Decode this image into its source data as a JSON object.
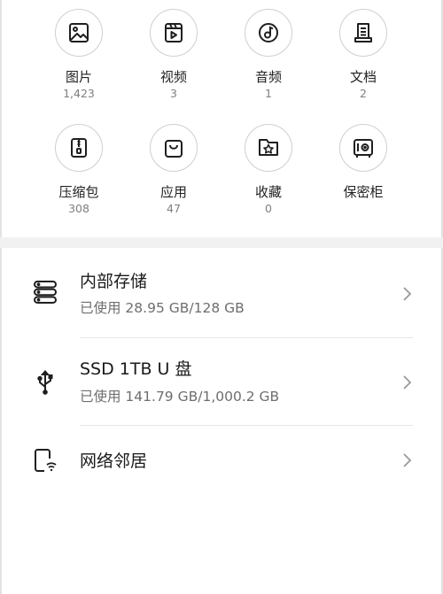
{
  "categories": [
    {
      "label": "图片",
      "count": "1,423",
      "icon": "image-icon"
    },
    {
      "label": "视频",
      "count": "3",
      "icon": "video-icon"
    },
    {
      "label": "音频",
      "count": "1",
      "icon": "audio-icon"
    },
    {
      "label": "文档",
      "count": "2",
      "icon": "document-icon"
    },
    {
      "label": "压缩包",
      "count": "308",
      "icon": "archive-icon"
    },
    {
      "label": "应用",
      "count": "47",
      "icon": "app-bag-icon"
    },
    {
      "label": "收藏",
      "count": "0",
      "icon": "favorites-icon"
    },
    {
      "label": "保密柜",
      "count": "",
      "icon": "safe-icon"
    }
  ],
  "storage": [
    {
      "title": "内部存储",
      "subtitle": "已使用 28.95 GB/128 GB",
      "icon": "internal-storage-icon"
    },
    {
      "title": "SSD 1TB U 盘",
      "subtitle": "已使用 141.79 GB/1,000.2 GB",
      "icon": "usb-icon"
    },
    {
      "title": "网络邻居",
      "subtitle": "",
      "icon": "network-neighbor-icon"
    }
  ],
  "colors": {
    "icon": "#1f1f1f",
    "circle_border": "#cfcfcf",
    "band": "#f1f1f1",
    "secondary_text": "#6e6e6e"
  }
}
